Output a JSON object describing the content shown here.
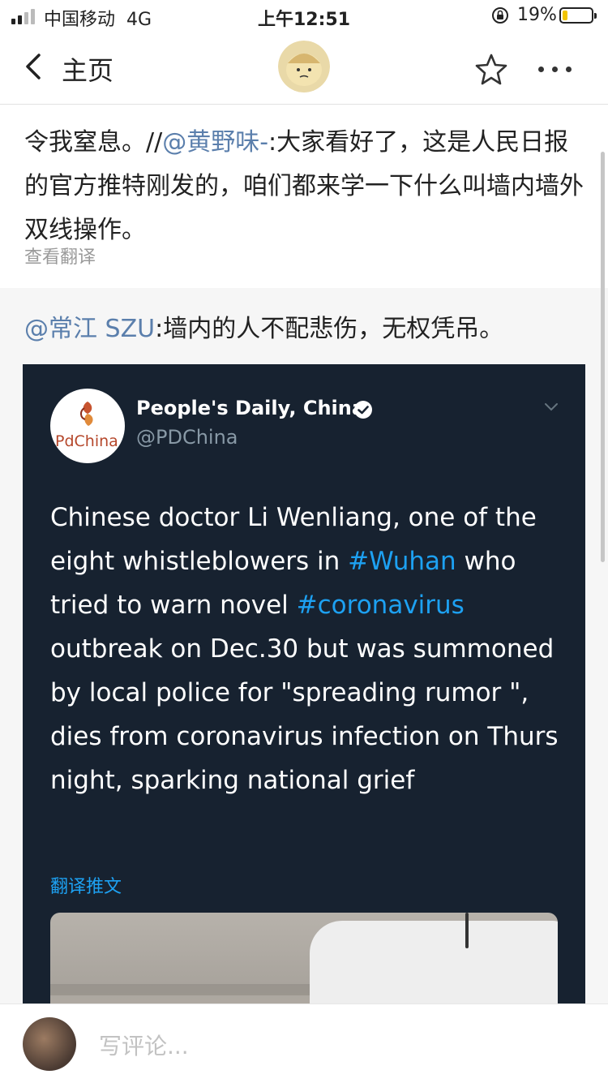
{
  "status_bar": {
    "carrier": "中国移动",
    "network": "4G",
    "time": "上午12:51",
    "battery": "19%",
    "battery_level": 0.19
  },
  "nav": {
    "back_label": "主页",
    "back_icon": "chevron-left-icon",
    "star_icon": "star-icon",
    "more_icon": "more-icon"
  },
  "post": {
    "text_prefix": "令我窒息。//",
    "mention": "@黄野味-",
    "text_main": ":大家看好了，这是人民日报的官方推特刚发的，咱们都来学一下什么叫墙内墙外双线操作。",
    "translate": "查看翻译"
  },
  "retweet": {
    "mention": "@常江 SZU",
    "text": ":墙内的人不配悲伤，无权凭吊。"
  },
  "tweet_card": {
    "account_name": "People's Daily, China",
    "handle": "@PDChina",
    "logo_text": "PdChina",
    "text_1": "Chinese doctor Li Wenliang, one of the eight whistleblowers in ",
    "tag_1": "#Wuhan",
    "text_2": " who tried to warn novel ",
    "tag_2": "#coronavirus",
    "text_3": " outbreak on Dec.30 but was summoned by local police for \"spreading rumor \", dies from coronavirus infection on Thurs night, sparking national grief",
    "translate": "翻译推文",
    "colors": {
      "background": "#172230",
      "link": "#1da1f2"
    }
  },
  "comment_bar": {
    "placeholder": "写评论..."
  }
}
